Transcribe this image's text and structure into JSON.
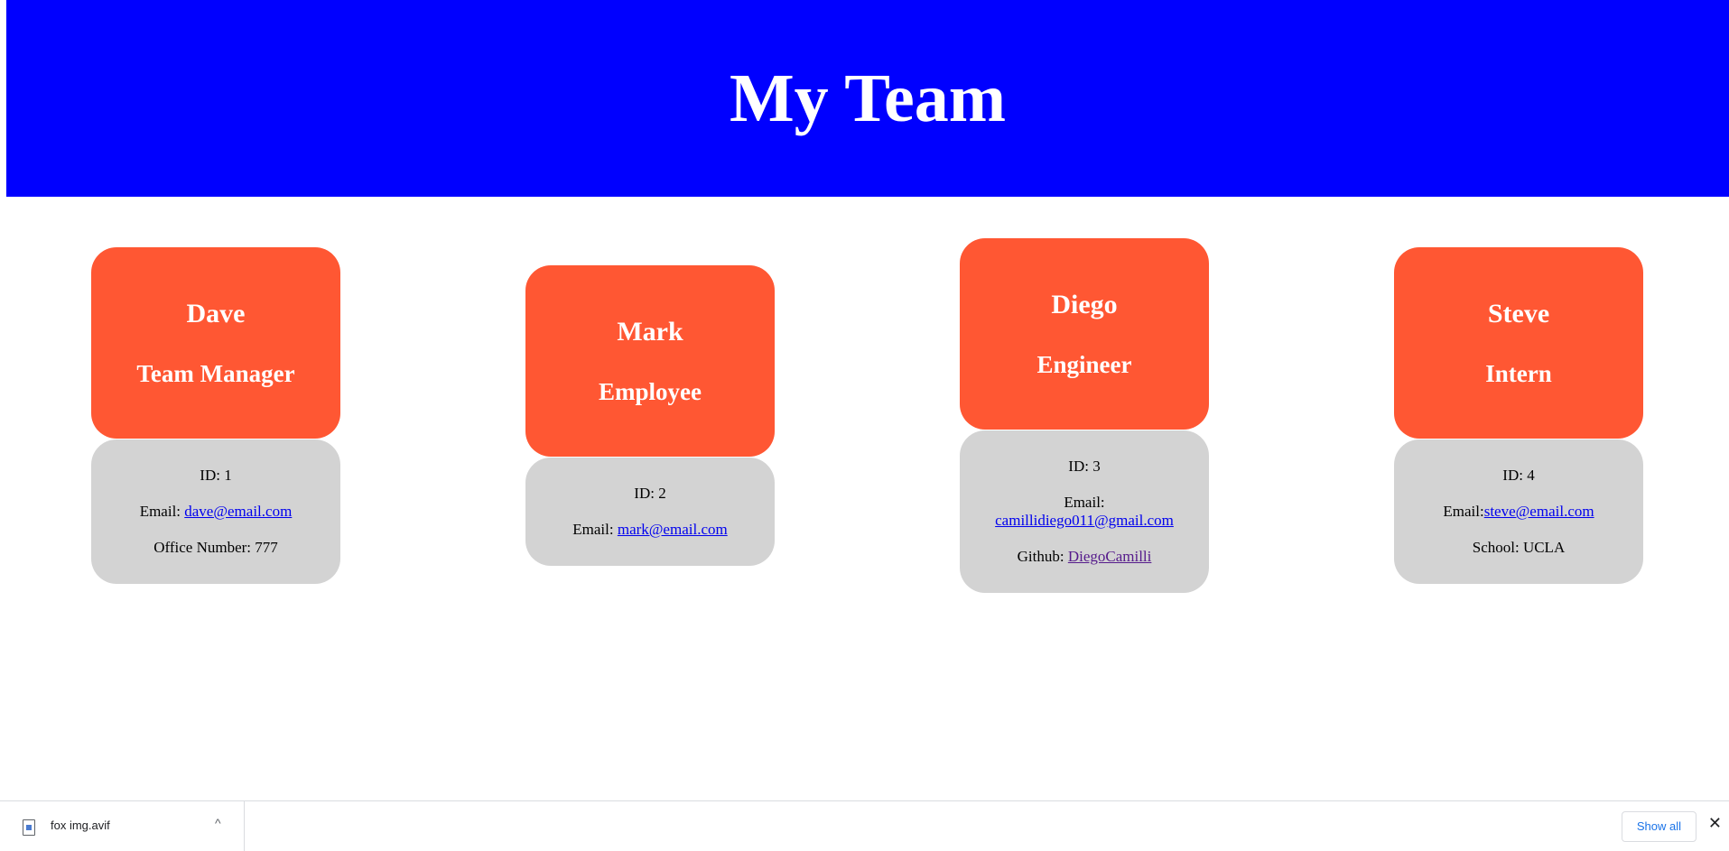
{
  "header": {
    "title": "My Team"
  },
  "team": [
    {
      "name": "Dave",
      "role": "Team Manager",
      "id_text": "ID: 1",
      "email_label": "Email: ",
      "email": "dave@email.com",
      "extra_label": "Office Number: 777"
    },
    {
      "name": "Mark",
      "role": "Employee",
      "id_text": "ID: 2",
      "email_label": "Email: ",
      "email": "mark@email.com"
    },
    {
      "name": "Diego",
      "role": "Engineer",
      "id_text": "ID: 3",
      "email_label": "Email:",
      "email": "camillidiego011@gmail.com",
      "github_label": "Github: ",
      "github": "DiegoCamilli"
    },
    {
      "name": "Steve",
      "role": "Intern",
      "id_text": "ID: 4",
      "email_label": "Email:",
      "email": "steve@email.com",
      "extra_label": "School: UCLA"
    }
  ],
  "downloads": {
    "file_name": "fox img.avif",
    "show_all_label": "Show all",
    "chevron": "^",
    "close": "✕"
  },
  "colors": {
    "header_bg": "#0000ff",
    "card_top": "#ff5733",
    "card_bottom": "#d3d3d3"
  }
}
